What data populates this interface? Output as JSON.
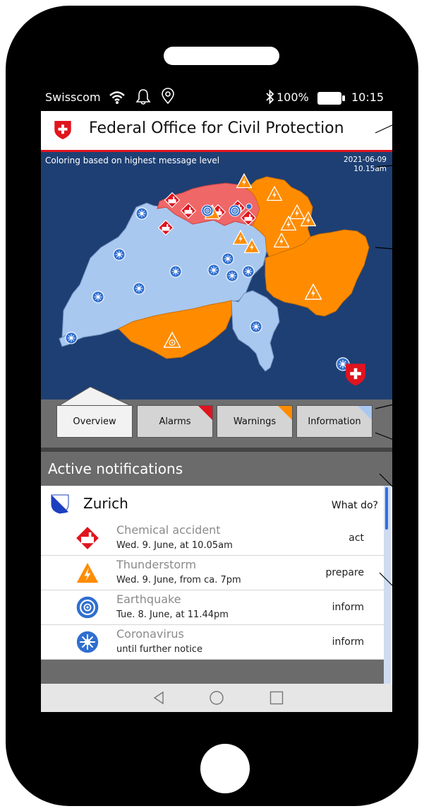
{
  "status_bar": {
    "carrier": "Swisscom",
    "battery": "100%",
    "time": "10:15",
    "icons": [
      "wifi-icon",
      "bell-icon",
      "location-icon",
      "bluetooth-icon",
      "battery-icon"
    ]
  },
  "header": {
    "title": "Federal Office for Civil Protection",
    "logo": "swiss-shield-logo"
  },
  "map": {
    "caption": "Coloring based on highest message level",
    "date": "2021-06-09",
    "time": "10.15am",
    "colors": {
      "alarm": "#f06767",
      "warning": "#ff8c00",
      "information": "#a9c8ef",
      "background": "#1e3f73"
    }
  },
  "tabs": [
    {
      "label": "Overview",
      "active": true
    },
    {
      "label": "Alarms",
      "corner_color": "#e0141e"
    },
    {
      "label": "Warnings",
      "corner_color": "#ff8c00"
    },
    {
      "label": "Information",
      "corner_color": "#a9c8ef"
    }
  ],
  "notifications": {
    "heading": "Active notifications",
    "region": "Zurich",
    "action_header": "What do?",
    "items": [
      {
        "title": "Chemical accident",
        "time": "Wed. 9. June, at 10.05am",
        "level": "act",
        "icon": "chemical-accident-icon"
      },
      {
        "title": "Thunderstorm",
        "time": "Wed. 9. June, from ca. 7pm",
        "level": "prepare",
        "icon": "thunderstorm-icon"
      },
      {
        "title": "Earthquake",
        "time": "Tue. 8. June, at 11.44pm",
        "level": "inform",
        "icon": "earthquake-icon"
      },
      {
        "title": "Coronavirus",
        "time": "until further notice",
        "level": "inform",
        "icon": "coronavirus-icon"
      }
    ]
  },
  "nav": [
    "back-icon",
    "home-icon",
    "recents-icon"
  ]
}
